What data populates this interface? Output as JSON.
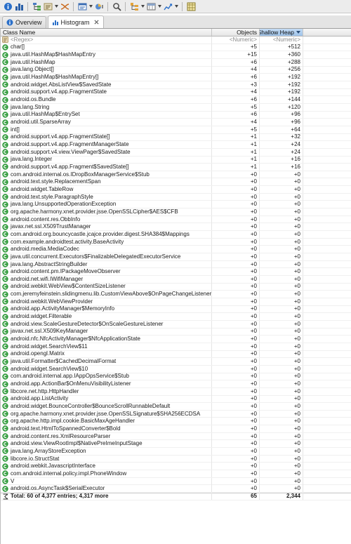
{
  "toolbar": {
    "buttons": [
      "info-icon",
      "histogram-icon",
      "dominator-tree-icon",
      "oql-icon",
      "thread-overview-icon",
      "query-browser-icon",
      "heap-dump-overview-icon",
      "search-icon",
      "group-by-icon",
      "calculate-retained-size-icon",
      "export-icon",
      "pin-icon"
    ]
  },
  "tabs": [
    {
      "label": "Overview",
      "active": false
    },
    {
      "label": "Histogram",
      "active": true
    }
  ],
  "table": {
    "headers": {
      "class_name": "Class Name",
      "objects": "Objects",
      "shallow_heap": "Shallow Heap"
    },
    "filter": {
      "class_name": "<Regex>",
      "objects": "<Numeric>",
      "shallow_heap": "<Numeric>"
    },
    "rows": [
      {
        "name": "char[]",
        "objects": "+5",
        "heap": "+512"
      },
      {
        "name": "java.util.HashMap$HashMapEntry",
        "objects": "+15",
        "heap": "+360"
      },
      {
        "name": "java.util.HashMap",
        "objects": "+6",
        "heap": "+288"
      },
      {
        "name": "java.lang.Object[]",
        "objects": "+4",
        "heap": "+256"
      },
      {
        "name": "java.util.HashMap$HashMapEntry[]",
        "objects": "+6",
        "heap": "+192"
      },
      {
        "name": "android.widget.AbsListView$SavedState",
        "objects": "+3",
        "heap": "+192"
      },
      {
        "name": "android.support.v4.app.FragmentState",
        "objects": "+4",
        "heap": "+192"
      },
      {
        "name": "android.os.Bundle",
        "objects": "+6",
        "heap": "+144"
      },
      {
        "name": "java.lang.String",
        "objects": "+5",
        "heap": "+120"
      },
      {
        "name": "java.util.HashMap$EntrySet",
        "objects": "+6",
        "heap": "+96"
      },
      {
        "name": "android.util.SparseArray",
        "objects": "+4",
        "heap": "+96"
      },
      {
        "name": "int[]",
        "objects": "+5",
        "heap": "+64"
      },
      {
        "name": "android.support.v4.app.FragmentState[]",
        "objects": "+1",
        "heap": "+32"
      },
      {
        "name": "android.support.v4.app.FragmentManagerState",
        "objects": "+1",
        "heap": "+24"
      },
      {
        "name": "android.support.v4.view.ViewPager$SavedState",
        "objects": "+1",
        "heap": "+24"
      },
      {
        "name": "java.lang.Integer",
        "objects": "+1",
        "heap": "+16"
      },
      {
        "name": "android.support.v4.app.Fragment$SavedState[]",
        "objects": "+1",
        "heap": "+16"
      },
      {
        "name": "com.android.internal.os.IDropBoxManagerService$Stub",
        "objects": "+0",
        "heap": "+0"
      },
      {
        "name": "android.text.style.ReplacementSpan",
        "objects": "+0",
        "heap": "+0"
      },
      {
        "name": "android.widget.TableRow",
        "objects": "+0",
        "heap": "+0"
      },
      {
        "name": "android.text.style.ParagraphStyle",
        "objects": "+0",
        "heap": "+0"
      },
      {
        "name": "java.lang.UnsupportedOperationException",
        "objects": "+0",
        "heap": "+0"
      },
      {
        "name": "org.apache.harmony.xnet.provider.jsse.OpenSSLCipher$AES$CFB",
        "objects": "+0",
        "heap": "+0"
      },
      {
        "name": "android.content.res.ObbInfo",
        "objects": "+0",
        "heap": "+0"
      },
      {
        "name": "javax.net.ssl.X509TrustManager",
        "objects": "+0",
        "heap": "+0"
      },
      {
        "name": "com.android.org.bouncycastle.jcajce.provider.digest.SHA384$Mappings",
        "objects": "+0",
        "heap": "+0"
      },
      {
        "name": "com.example.androidtest.activity.BaseActivity",
        "objects": "+0",
        "heap": "+0"
      },
      {
        "name": "android.media.MediaCodec",
        "objects": "+0",
        "heap": "+0"
      },
      {
        "name": "java.util.concurrent.Executors$FinalizableDelegatedExecutorService",
        "objects": "+0",
        "heap": "+0"
      },
      {
        "name": "java.lang.AbstractStringBuilder",
        "objects": "+0",
        "heap": "+0"
      },
      {
        "name": "android.content.pm.IPackageMoveObserver",
        "objects": "+0",
        "heap": "+0"
      },
      {
        "name": "android.net.wifi.IWifiManager",
        "objects": "+0",
        "heap": "+0"
      },
      {
        "name": "android.webkit.WebView$ContentSizeListener",
        "objects": "+0",
        "heap": "+0"
      },
      {
        "name": "com.jeremyfeinstein.slidingmenu.lib.CustomViewAbove$OnPageChangeListener",
        "objects": "+0",
        "heap": "+0"
      },
      {
        "name": "android.webkit.WebViewProvider",
        "objects": "+0",
        "heap": "+0"
      },
      {
        "name": "android.app.ActivityManager$MemoryInfo",
        "objects": "+0",
        "heap": "+0"
      },
      {
        "name": "android.widget.Filterable",
        "objects": "+0",
        "heap": "+0"
      },
      {
        "name": "android.view.ScaleGestureDetector$OnScaleGestureListener",
        "objects": "+0",
        "heap": "+0"
      },
      {
        "name": "javax.net.ssl.X509KeyManager",
        "objects": "+0",
        "heap": "+0"
      },
      {
        "name": "android.nfc.NfcActivityManager$NfcApplicationState",
        "objects": "+0",
        "heap": "+0"
      },
      {
        "name": "android.widget.SearchView$11",
        "objects": "+0",
        "heap": "+0"
      },
      {
        "name": "android.opengl.Matrix",
        "objects": "+0",
        "heap": "+0"
      },
      {
        "name": "java.util.Formatter$CachedDecimalFormat",
        "objects": "+0",
        "heap": "+0"
      },
      {
        "name": "android.widget.SearchView$10",
        "objects": "+0",
        "heap": "+0"
      },
      {
        "name": "com.android.internal.app.IAppOpsService$Stub",
        "objects": "+0",
        "heap": "+0"
      },
      {
        "name": "android.app.ActionBar$OnMenuVisibilityListener",
        "objects": "+0",
        "heap": "+0"
      },
      {
        "name": "libcore.net.http.HttpHandler",
        "objects": "+0",
        "heap": "+0"
      },
      {
        "name": "android.app.ListActivity",
        "objects": "+0",
        "heap": "+0"
      },
      {
        "name": "android.widget.BounceController$BounceScrollRunnableDefault",
        "objects": "+0",
        "heap": "+0"
      },
      {
        "name": "org.apache.harmony.xnet.provider.jsse.OpenSSLSignature$SHA256ECDSA",
        "objects": "+0",
        "heap": "+0"
      },
      {
        "name": "org.apache.http.impl.cookie.BasicMaxAgeHandler",
        "objects": "+0",
        "heap": "+0"
      },
      {
        "name": "android.text.HtmlToSpannedConverter$Bold",
        "objects": "+0",
        "heap": "+0"
      },
      {
        "name": "android.content.res.XmlResourceParser",
        "objects": "+0",
        "heap": "+0"
      },
      {
        "name": "android.view.ViewRootImpl$NativePreImeInputStage",
        "objects": "+0",
        "heap": "+0"
      },
      {
        "name": "java.lang.ArrayStoreException",
        "objects": "+0",
        "heap": "+0"
      },
      {
        "name": "libcore.io.StructStat",
        "objects": "+0",
        "heap": "+0"
      },
      {
        "name": "android.webkit.JavascriptInterface",
        "objects": "+0",
        "heap": "+0"
      },
      {
        "name": "com.android.internal.policy.impl.PhoneWindow",
        "objects": "+0",
        "heap": "+0"
      },
      {
        "name": "V",
        "objects": "+0",
        "heap": "+0"
      },
      {
        "name": "android.os.AsyncTask$SerialExecutor",
        "objects": "+0",
        "heap": "+0"
      }
    ],
    "total": {
      "label": "Total: 60 of 4,377 entries; 4,317 more",
      "objects": "65",
      "heap": "2,344"
    }
  },
  "colors": {
    "class_icon": "#2f9a3a",
    "header_sorted": "#a9cbee"
  }
}
